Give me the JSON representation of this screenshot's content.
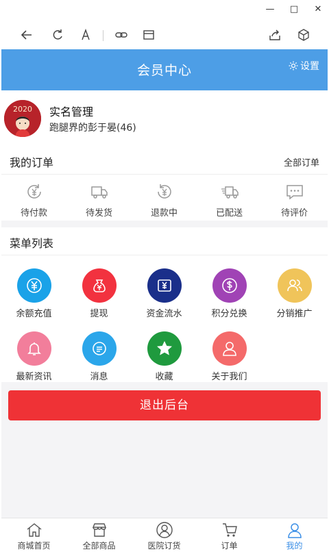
{
  "window": {
    "minimize": "—",
    "maximize": "□",
    "close": "✕"
  },
  "header": {
    "title": "会员中心",
    "settings_label": "设置"
  },
  "profile": {
    "verify_label": "实名管理",
    "username": "跑腿界的彭于晏(46)",
    "avatar_text": "2020"
  },
  "orders": {
    "title": "我的订单",
    "all_label": "全部订单",
    "items": [
      {
        "label": "待付款",
        "icon": "yen-refresh-icon"
      },
      {
        "label": "待发货",
        "icon": "truck-icon"
      },
      {
        "label": "退款中",
        "icon": "refund-icon"
      },
      {
        "label": "已配送",
        "icon": "delivery-truck-icon"
      },
      {
        "label": "待评价",
        "icon": "comment-icon"
      }
    ]
  },
  "menu": {
    "title": "菜单列表",
    "items": [
      {
        "label": "余额充值",
        "icon": "yen-icon",
        "color": "#1aa2e8"
      },
      {
        "label": "提现",
        "icon": "money-bag-icon",
        "color": "#f2323f"
      },
      {
        "label": "资金流水",
        "icon": "yen-box-icon",
        "color": "#1a2f8a"
      },
      {
        "label": "积分兑换",
        "icon": "dollar-icon",
        "color": "#a043b5"
      },
      {
        "label": "分销推广",
        "icon": "users-icon",
        "color": "#f0c45a"
      },
      {
        "label": "最新资讯",
        "icon": "bell-icon",
        "color": "#f27e9b"
      },
      {
        "label": "消息",
        "icon": "message-icon",
        "color": "#2ba6ea"
      },
      {
        "label": "收藏",
        "icon": "star-icon",
        "color": "#1f9a3e"
      },
      {
        "label": "关于我们",
        "icon": "user-icon",
        "color": "#f46a6a"
      }
    ]
  },
  "logout_label": "退出后台",
  "tabbar": {
    "items": [
      {
        "label": "商城首页",
        "icon": "home-icon",
        "active": false
      },
      {
        "label": "全部商品",
        "icon": "shop-icon",
        "active": false
      },
      {
        "label": "医院订货",
        "icon": "person-icon",
        "active": false
      },
      {
        "label": "订单",
        "icon": "cart-icon",
        "active": false
      },
      {
        "label": "我的",
        "icon": "profile-icon",
        "active": true
      }
    ],
    "active_color": "#3a8ee6"
  }
}
